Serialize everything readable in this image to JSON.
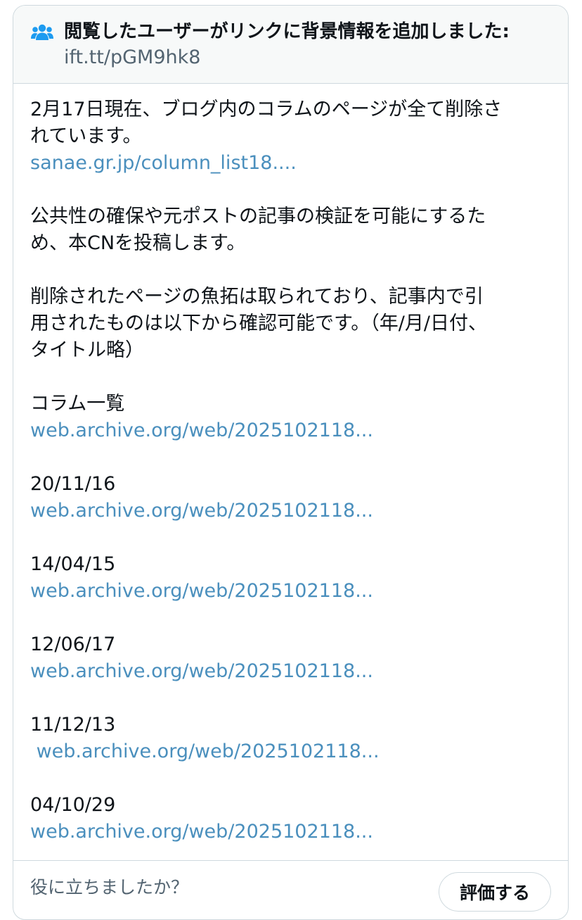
{
  "note": {
    "header_title": "閲覧したユーザーがリンクに背景情報を追加しました:",
    "header_link": "ift.tt/pGM9hk8",
    "header_icon": "people-icon",
    "paragraph1_line1": "2月17日現在、ブログ内のコラムのページが全て削除さ",
    "paragraph1_line2": "れています。",
    "paragraph1_link": "sanae.gr.jp/column_list18....",
    "paragraph2_line1": "公共性の確保や元ポストの記事の検証を可能にするた",
    "paragraph2_line2": "め、本CNを投稿します。",
    "paragraph3_line1": "削除されたページの魚拓は取られており、記事内で引",
    "paragraph3_line2": "用されたものは以下から確認可能です。（年/月/日付、",
    "paragraph3_line3": "タイトル略）",
    "entries": [
      {
        "label": "コラム一覧",
        "link": "web.archive.org/web/2025102118..."
      },
      {
        "label": "20/11/16",
        "link": "web.archive.org/web/2025102118..."
      },
      {
        "label": "14/04/15",
        "link": "web.archive.org/web/2025102118..."
      },
      {
        "label": "12/06/17",
        "link": "web.archive.org/web/2025102118..."
      },
      {
        "label": "11/12/13",
        "link": " web.archive.org/web/2025102118..."
      },
      {
        "label": "04/10/29",
        "link": "web.archive.org/web/2025102118..."
      }
    ]
  },
  "footer": {
    "question": "役に立ちましたか？",
    "rate_button": "評価する"
  },
  "colors": {
    "link": "#4a8fbd",
    "header_icon": "#1d9bf0",
    "muted_text": "#536471",
    "border": "#cfd9de",
    "header_bg": "#f7f9f9"
  }
}
